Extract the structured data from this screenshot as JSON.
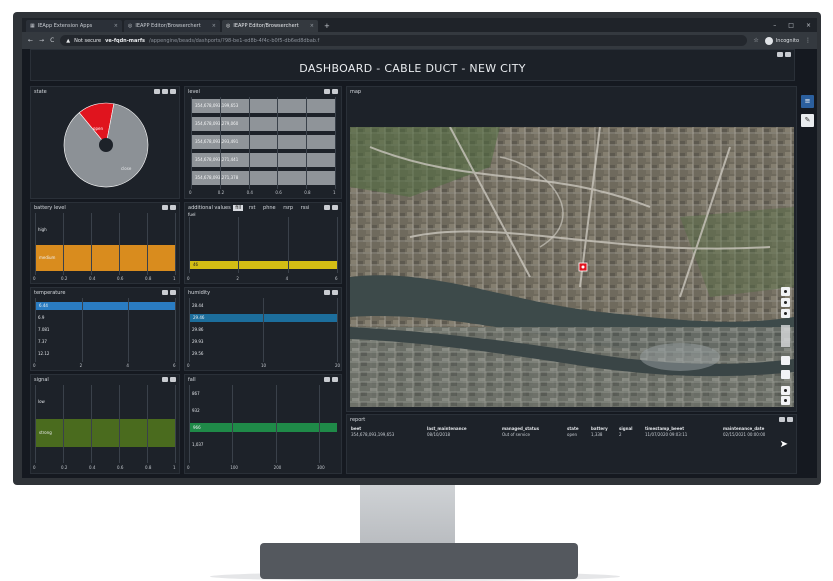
{
  "browser": {
    "tabs": [
      {
        "label": "IEApp Extension Apps",
        "active": false
      },
      {
        "label": "IEAPP Editor/Browserchert",
        "active": false
      },
      {
        "label": "IEAPP Editor/Browserchert",
        "active": true
      }
    ],
    "new_tab": "+",
    "window_controls": [
      "–",
      "□",
      "×"
    ],
    "nav": {
      "back": "←",
      "forward": "→",
      "reload": "C"
    },
    "url": {
      "security": "Not secure",
      "host": "ve-fqdn-marfs",
      "path": "/appengine/beads/dashports/?98-be1-ed8b-4f4c-b0f5-db6ed8dbab.f"
    },
    "profile_label": "Incognito"
  },
  "dashboard": {
    "title": "DASHBOARD - CABLE DUCT - NEW CITY",
    "sidebar_button": "≡",
    "edit_button": "✎"
  },
  "panels": {
    "state": {
      "title": "state",
      "slices": [
        {
          "label": "open",
          "value": 14,
          "color": "#e0141e"
        },
        {
          "label": "close",
          "value": 86,
          "color": "#8c9196"
        }
      ]
    },
    "level": {
      "title": "level",
      "rows": [
        "354,678,093,199,653",
        "354,678,093,279,060",
        "354,678,093,293,491",
        "354,678,093,271,441",
        "354,678,093,271,378"
      ],
      "ticks": [
        "0",
        "0.2",
        "0.4",
        "0.6",
        "0.8",
        "1"
      ]
    },
    "battery": {
      "title": "battery level",
      "rows": [
        {
          "label": "high",
          "value": 0,
          "color": "#1d2229"
        },
        {
          "label": "medium",
          "value": 1,
          "color": "#d98c1e"
        }
      ],
      "ticks": [
        "0",
        "0.2",
        "0.4",
        "0.6",
        "0.8",
        "1"
      ]
    },
    "additional": {
      "title": "additional values",
      "tabs": [
        "fill",
        "rst",
        "phne",
        "rsrp",
        "rssi"
      ],
      "active_tab": "fill",
      "subtitle": "fuel",
      "bar_label": "46",
      "bar_value": 1,
      "bar_color": "#d4be14",
      "ticks": [
        "0",
        "2",
        "4",
        "6"
      ]
    },
    "temperature": {
      "title": "temperature",
      "rows": [
        {
          "label": "6.44",
          "value": 1
        },
        {
          "label": "6.9",
          "value": 0
        },
        {
          "label": "7.081",
          "value": 0
        },
        {
          "label": "7.37",
          "value": 0
        },
        {
          "label": "12.12",
          "value": 0
        }
      ],
      "bar_color": "#2a7cc2",
      "ticks": [
        "0",
        "2",
        "4",
        "6"
      ]
    },
    "humidity": {
      "title": "humidity",
      "rows": [
        {
          "label": "28.44",
          "value": 0
        },
        {
          "label": "29.46",
          "value": 1
        },
        {
          "label": "29.86",
          "value": 0
        },
        {
          "label": "29.93",
          "value": 0
        },
        {
          "label": "29.56",
          "value": 0
        }
      ],
      "bar_color": "#1c6e9c",
      "ticks": [
        "0",
        "10",
        "20"
      ]
    },
    "signal": {
      "title": "signal",
      "rows": [
        {
          "label": "low",
          "value": 0
        },
        {
          "label": "strong",
          "value": 1
        }
      ],
      "bar_color": "#4a6b1e",
      "ticks": [
        "0",
        "0.2",
        "0.4",
        "0.6",
        "0.8",
        "1"
      ]
    },
    "fall": {
      "title": "fall",
      "rows": [
        {
          "label": "867",
          "value": 0
        },
        {
          "label": "932",
          "value": 0
        },
        {
          "label": "966",
          "value": 1
        },
        {
          "label": "1,037",
          "value": 0
        }
      ],
      "bar_color": "#1f8a48",
      "ticks": [
        "0",
        "100",
        "200",
        "300"
      ]
    },
    "map": {
      "title": "map",
      "marker": "sensor",
      "controls": [
        "+",
        "−",
        "⤢",
        "◧",
        "✥"
      ]
    },
    "report": {
      "title": "report",
      "columns": [
        "beet",
        "last_maintenance",
        "managed_status",
        "state",
        "battery",
        "signal",
        "timestamp_beeet",
        "maintenance_date"
      ],
      "rows": [
        [
          "354,678,093,199,653",
          "08/10/2018",
          "Out of service",
          "open",
          "1,338",
          "2",
          "11/07/2020 09:03:11",
          "02/15/2021 00:00:00"
        ]
      ]
    }
  }
}
